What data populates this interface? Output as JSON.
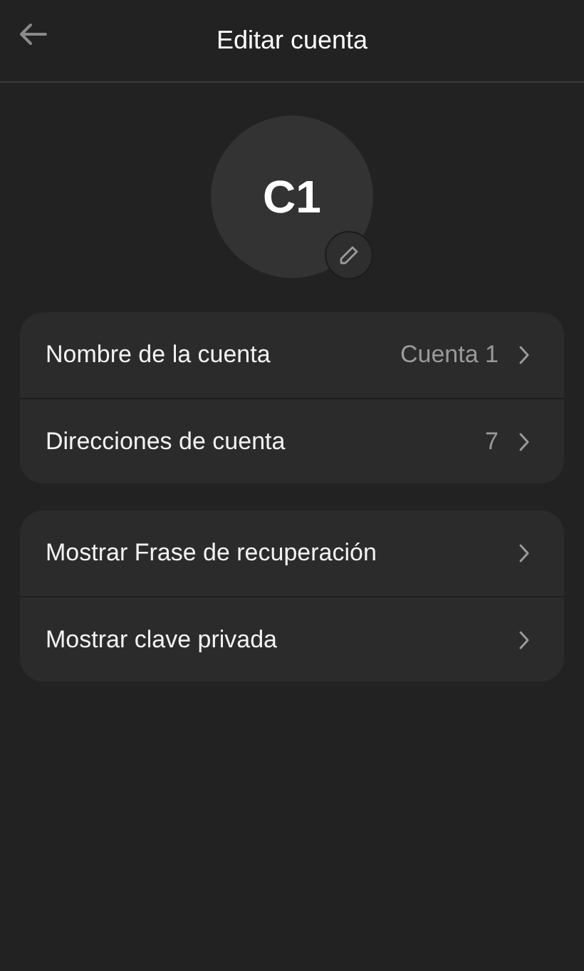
{
  "header": {
    "title": "Editar cuenta"
  },
  "avatar": {
    "initials": "C1"
  },
  "groups": [
    {
      "rows": [
        {
          "label": "Nombre de la cuenta",
          "value": "Cuenta 1"
        },
        {
          "label": "Direcciones de cuenta",
          "value": "7"
        }
      ]
    },
    {
      "rows": [
        {
          "label": "Mostrar Frase de recuperación"
        },
        {
          "label": "Mostrar clave privada"
        }
      ]
    }
  ]
}
